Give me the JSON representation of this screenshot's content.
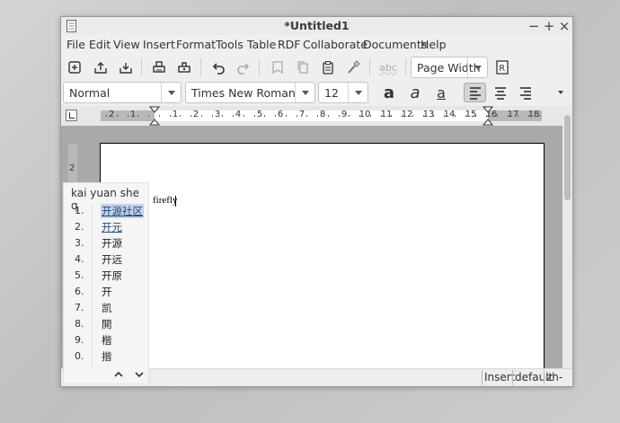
{
  "window": {
    "title": "*Untitled1",
    "buttons": {
      "minimize": "−",
      "maximize": "+",
      "close": "×"
    }
  },
  "menu": [
    "File",
    "Edit",
    "View",
    "Insert",
    "Format",
    "Tools",
    "Table",
    "RDF",
    "Collaborate",
    "Documents",
    "Help"
  ],
  "toolbar": {
    "icons": [
      "new-document-icon",
      "open-icon",
      "save-icon",
      "print-icon",
      "print-preview-icon",
      "undo-icon",
      "redo-icon",
      "comment-icon",
      "copy-icon",
      "paste-icon",
      "format-painter-icon",
      "spellcheck-icon"
    ],
    "spellcheck_label": "abc",
    "zoom": "Page Width"
  },
  "format_bar": {
    "style": "Normal",
    "font": "Times New Roman",
    "size": "12",
    "bold": "a",
    "italic": "a",
    "underline": "a",
    "icons": [
      "align-left-icon",
      "align-center-icon",
      "align-right-icon",
      "more-icon"
    ]
  },
  "ruler": {
    "h_labels": [
      "2",
      "1",
      "1",
      "2",
      "3",
      "4",
      "5",
      "6",
      "7",
      "8",
      "9",
      "10",
      "11",
      "12",
      "13",
      "14",
      "15",
      "16",
      "17",
      "18"
    ],
    "v_labels": [
      "2",
      "1"
    ]
  },
  "document": {
    "text": "firefly"
  },
  "ime": {
    "preedit": "kai yuan she q",
    "candidates": [
      {
        "index": "1.",
        "word": "开源社区"
      },
      {
        "index": "2.",
        "word": "开元"
      },
      {
        "index": "3.",
        "word": "开源"
      },
      {
        "index": "4.",
        "word": "开远"
      },
      {
        "index": "5.",
        "word": "开原"
      },
      {
        "index": "6.",
        "word": "开"
      },
      {
        "index": "7.",
        "word": "凯"
      },
      {
        "index": "8.",
        "word": "開"
      },
      {
        "index": "9.",
        "word": "楷"
      },
      {
        "index": "0.",
        "word": "揩"
      }
    ],
    "prev": "^",
    "next": "v"
  },
  "status": {
    "mode": "Insert",
    "dictionary": "default",
    "language": "zh-CN"
  }
}
